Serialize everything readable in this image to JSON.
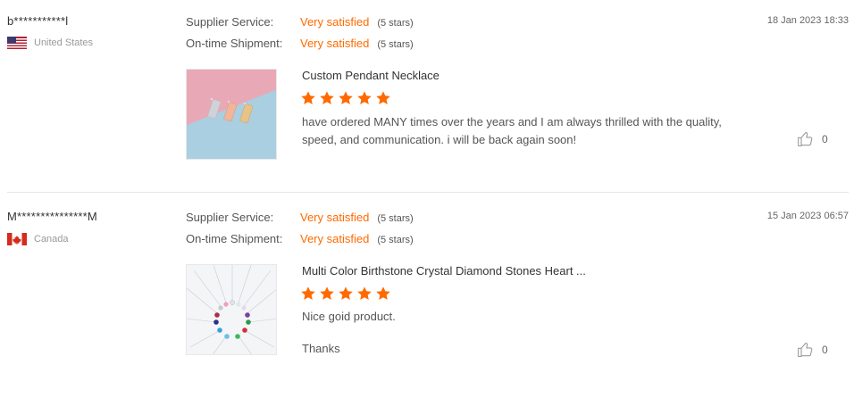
{
  "reviews": [
    {
      "username": "b***********l",
      "country": "United States",
      "flag_icon": "us-flag-icon",
      "date": "18 Jan 2023 18:33",
      "ratings": [
        {
          "label": "Supplier Service:",
          "value": "Very satisfied",
          "stars_text": "(5 stars)"
        },
        {
          "label": "On-time Shipment:",
          "value": "Very satisfied",
          "stars_text": "(5 stars)"
        }
      ],
      "product_title": "Custom Pendant Necklace",
      "product_stars": 5,
      "comment_lines": [
        "have ordered MANY times over the years and I am always thrilled with the quality,",
        "speed, and communication. i will be back again soon!"
      ],
      "likes": "0"
    },
    {
      "username": "M***************M",
      "country": "Canada",
      "flag_icon": "canada-flag-icon",
      "date": "15 Jan 2023 06:57",
      "ratings": [
        {
          "label": "Supplier Service:",
          "value": "Very satisfied",
          "stars_text": "(5 stars)"
        },
        {
          "label": "On-time Shipment:",
          "value": "Very satisfied",
          "stars_text": "(5 stars)"
        }
      ],
      "product_title": "Multi Color Birthstone Crystal Diamond Stones Heart ...",
      "product_stars": 5,
      "comment_lines": [
        "Nice goid product.",
        "",
        "Thanks"
      ],
      "likes": "0"
    }
  ],
  "colors": {
    "accent": "#ff6a00",
    "star": "#ff6a00"
  }
}
